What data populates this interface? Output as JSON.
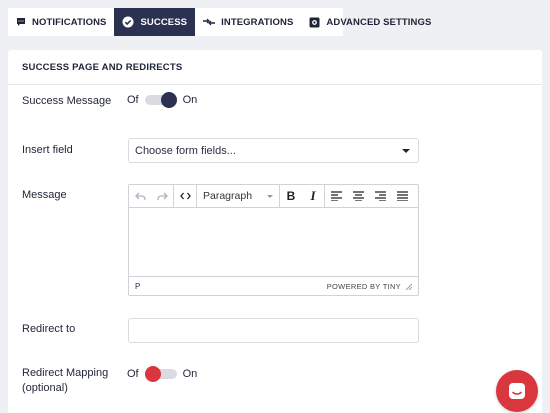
{
  "tabs": [
    {
      "label": "NOTIFICATIONS",
      "icon": "message-icon",
      "active": false
    },
    {
      "label": "SUCCESS",
      "icon": "check-circle-icon",
      "active": true
    },
    {
      "label": "INTEGRATIONS",
      "icon": "integrations-icon",
      "active": false
    },
    {
      "label": "ADVANCED SETTINGS",
      "icon": "settings-icon",
      "active": false
    }
  ],
  "section_title": "SUCCESS PAGE AND REDIRECTS",
  "success_message": {
    "label": "Success Message",
    "off_label": "Of",
    "on_label": "On",
    "state": "on"
  },
  "insert_field": {
    "label": "Insert field",
    "value": "Choose form fields..."
  },
  "message": {
    "label": "Message",
    "format_value": "Paragraph",
    "status_path": "P",
    "powered_by": "POWERED BY TINY"
  },
  "redirect_to": {
    "label": "Redirect to",
    "value": ""
  },
  "redirect_mapping": {
    "label_line1": "Redirect Mapping",
    "label_line2": "(optional)",
    "off_label": "Of",
    "on_label": "On",
    "state": "off"
  },
  "colors": {
    "accent_dark": "#2b3150",
    "danger": "#d9363e"
  }
}
